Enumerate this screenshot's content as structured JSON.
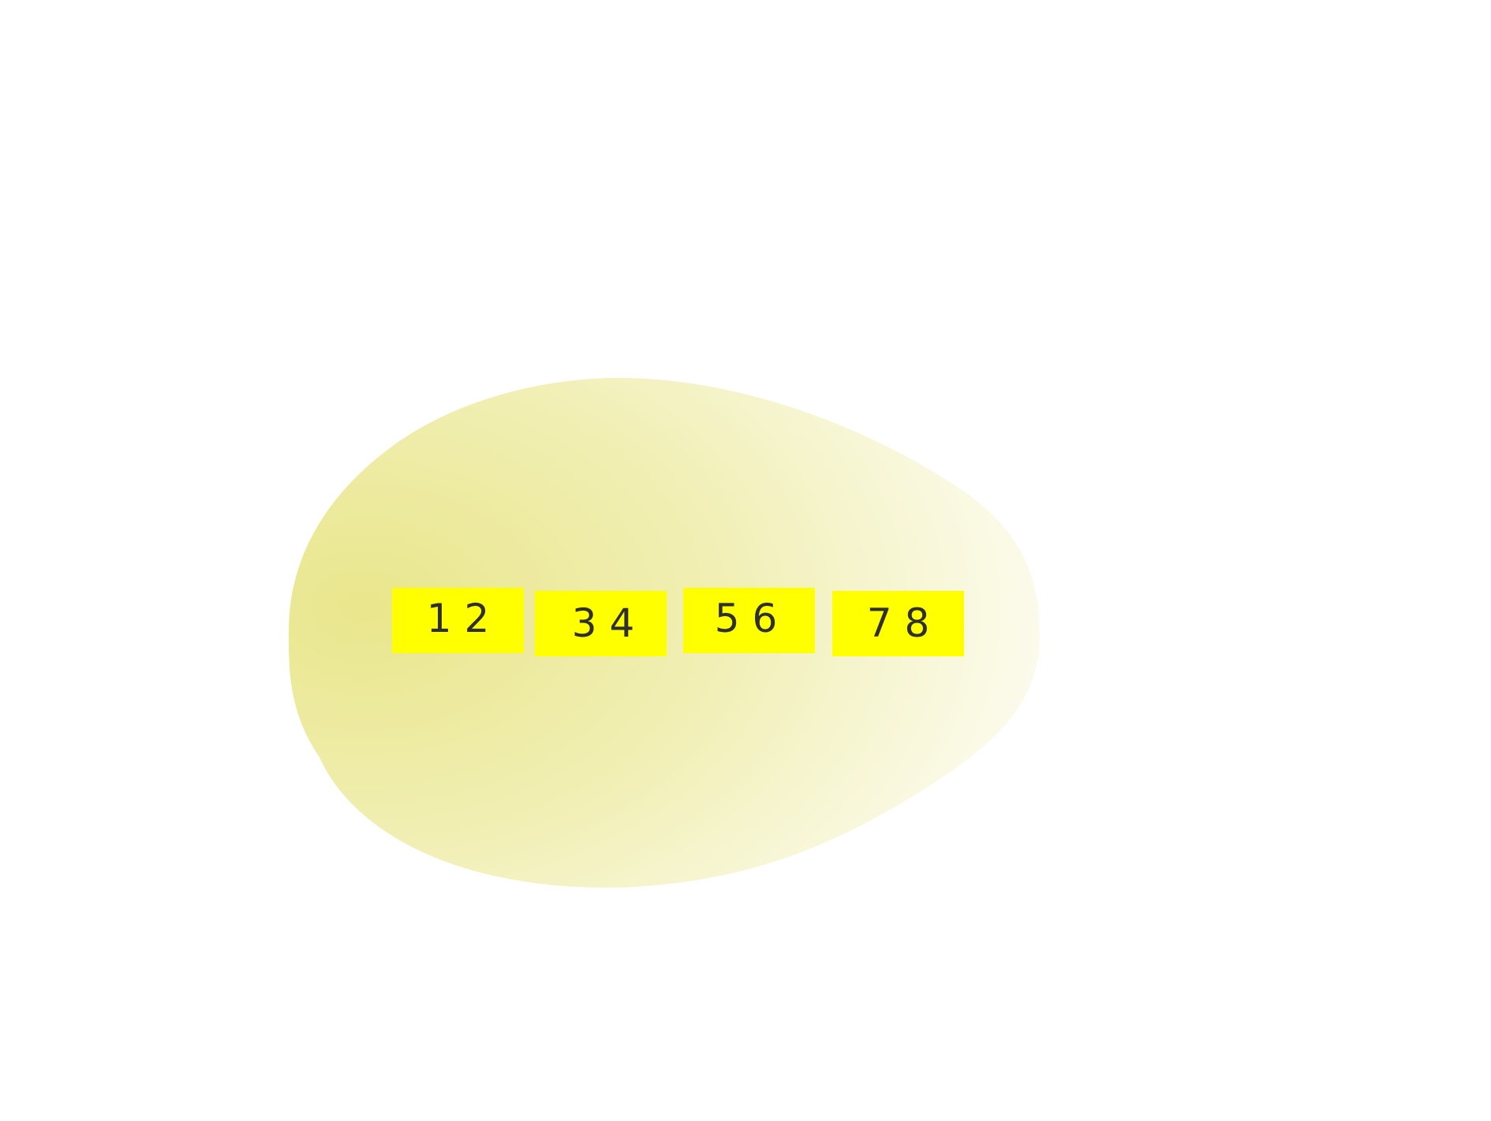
{
  "colors": {
    "blob_fill_start": "#e9e68c",
    "blob_fill_end": "#ffffff",
    "box_fill": "#ffff00",
    "text_color": "#2f2f2f"
  },
  "boxes": [
    {
      "label": "1 2"
    },
    {
      "label": "3 4"
    },
    {
      "label": "5 6"
    },
    {
      "label": "7 8"
    }
  ]
}
